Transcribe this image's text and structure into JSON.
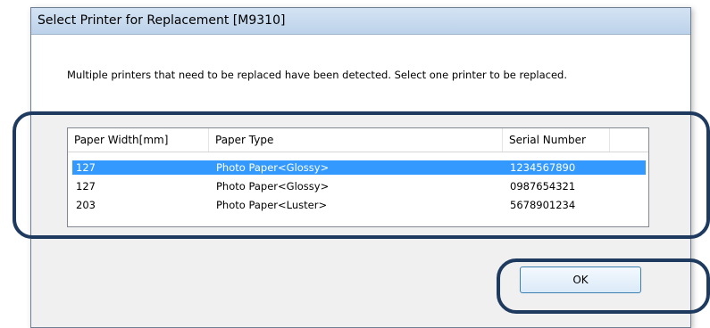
{
  "dialog": {
    "title": "Select Printer for Replacement [M9310]",
    "message": "Multiple printers that need to be replaced have been detected. Select one printer to be replaced."
  },
  "list": {
    "columns": [
      "Paper Width[mm]",
      "Paper Type",
      "Serial Number"
    ],
    "rows": [
      {
        "width": "127",
        "type": "Photo Paper<Glossy>",
        "serial": "1234567890",
        "selected": true
      },
      {
        "width": "127",
        "type": "Photo Paper<Glossy>",
        "serial": "0987654321",
        "selected": false
      },
      {
        "width": "203",
        "type": "Photo Paper<Luster>",
        "serial": "5678901234",
        "selected": false
      }
    ]
  },
  "buttons": {
    "ok_label": "OK"
  },
  "colors": {
    "selection": "#3399ff",
    "highlight_frame": "#1e3a5f"
  }
}
